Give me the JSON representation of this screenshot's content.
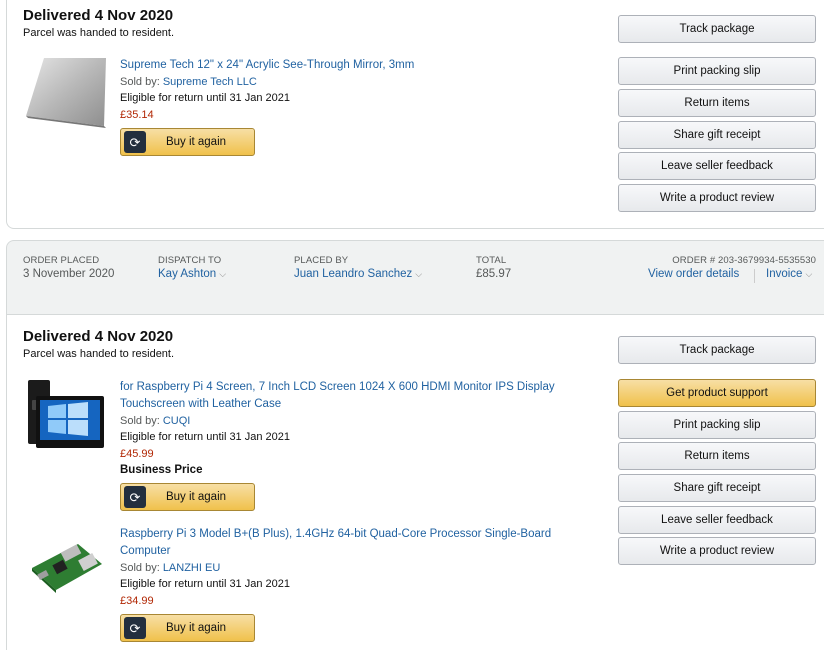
{
  "order1": {
    "delivered": "Delivered 4 Nov 2020",
    "status": "Parcel was handed to resident.",
    "items": [
      {
        "title": "Supreme Tech 12\" x 24\" Acrylic See-Through Mirror, 3mm",
        "sold_by_label": "Sold by:",
        "seller": "Supreme Tech LLC",
        "eligibility": "Eligible for return until 31 Jan 2021",
        "price": "£35.14",
        "buy_again": "Buy it again"
      }
    ],
    "actions": [
      "Track package",
      "Print packing slip",
      "Return items",
      "Share gift receipt",
      "Leave seller feedback",
      "Write a product review"
    ]
  },
  "order2_header": {
    "order_placed_label": "ORDER PLACED",
    "order_placed": "3 November 2020",
    "dispatch_label": "DISPATCH TO",
    "dispatch_to": "Kay Ashton",
    "placed_by_label": "PLACED BY",
    "placed_by": "Juan Leandro Sanchez",
    "total_label": "TOTAL",
    "total": "£85.97",
    "order_number": "ORDER # 203-3679934-5535530",
    "view_details": "View order details",
    "invoice": "Invoice"
  },
  "order2": {
    "delivered": "Delivered 4 Nov 2020",
    "status": "Parcel was handed to resident.",
    "items": [
      {
        "title_line1": "for Raspberry Pi 4 Screen, 7 Inch LCD Screen 1024 X 600 HDMI Monitor IPS Display",
        "title_line2": "Touchscreen with Leather Case",
        "sold_by_label": "Sold by:",
        "seller": "CUQI",
        "eligibility": "Eligible for return until 31 Jan 2021",
        "price": "£45.99",
        "business_price": "Business Price",
        "buy_again": "Buy it again"
      },
      {
        "title_line1": "Raspberry Pi 3 Model B+(B Plus), 1.4GHz 64-bit Quad-Core Processor Single-Board",
        "title_line2": "Computer",
        "sold_by_label": "Sold by:",
        "seller": "LANZHI EU",
        "eligibility": "Eligible for return until 31 Jan 2021",
        "price": "£34.99",
        "buy_again": "Buy it again"
      }
    ],
    "actions": [
      "Track package",
      "Get product support",
      "Print packing slip",
      "Return items",
      "Share gift receipt",
      "Leave seller feedback",
      "Write a product review"
    ]
  },
  "colors": {
    "link": "#2162a1",
    "price": "#b12704",
    "primary_button": "#f0c14b"
  },
  "icons": {
    "buy_again": "reorder-icon",
    "caret": "chevron-down-icon"
  }
}
